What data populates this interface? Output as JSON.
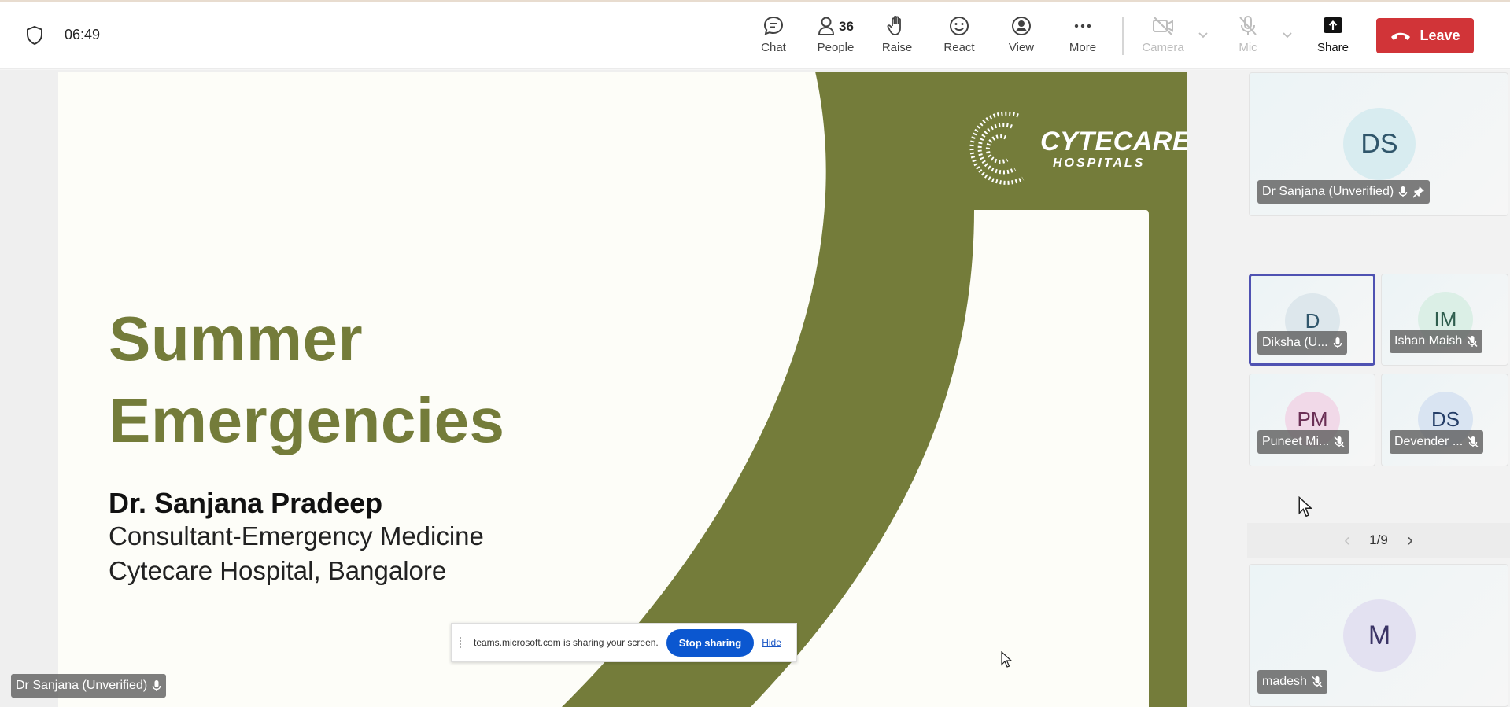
{
  "meeting": {
    "timer": "06:49",
    "toolbar": {
      "chat": "Chat",
      "people": "People",
      "people_count": "36",
      "raise": "Raise",
      "react": "React",
      "view": "View",
      "more": "More",
      "camera": "Camera",
      "mic": "Mic",
      "share": "Share",
      "leave": "Leave"
    }
  },
  "slide": {
    "title_line1": "Summer",
    "title_line2": "Emergencies",
    "speaker": "Dr. Sanjana Pradeep",
    "role": "Consultant-Emergency Medicine",
    "hospital": "Cytecare Hospital, Bangalore",
    "logo_main": "CYTECARE",
    "logo_sub": "HOSPITALS",
    "presenter_tag": "Dr Sanjana (Unverified)"
  },
  "share_bar": {
    "message": "teams.microsoft.com is sharing your screen.",
    "stop": "Stop sharing",
    "hide": "Hide"
  },
  "participants": {
    "pinned": {
      "initials": "DS",
      "name": "Dr Sanjana (Unverified)"
    },
    "grid": [
      {
        "initials": "D",
        "name": "Diksha (U...",
        "muted": false,
        "active": true
      },
      {
        "initials": "IM",
        "name": "Ishan Maish",
        "muted": true,
        "active": false
      },
      {
        "initials": "PM",
        "name": "Puneet Mi...",
        "muted": true,
        "active": false
      },
      {
        "initials": "DS",
        "name": "Devender ...",
        "muted": true,
        "active": false
      }
    ],
    "page": "1/9",
    "bottom": {
      "initials": "M",
      "name": "madesh"
    }
  },
  "colors": {
    "leave": "#d13438",
    "olive": "#747c3a",
    "accent": "#4f52b2",
    "stop": "#0b57d0"
  }
}
